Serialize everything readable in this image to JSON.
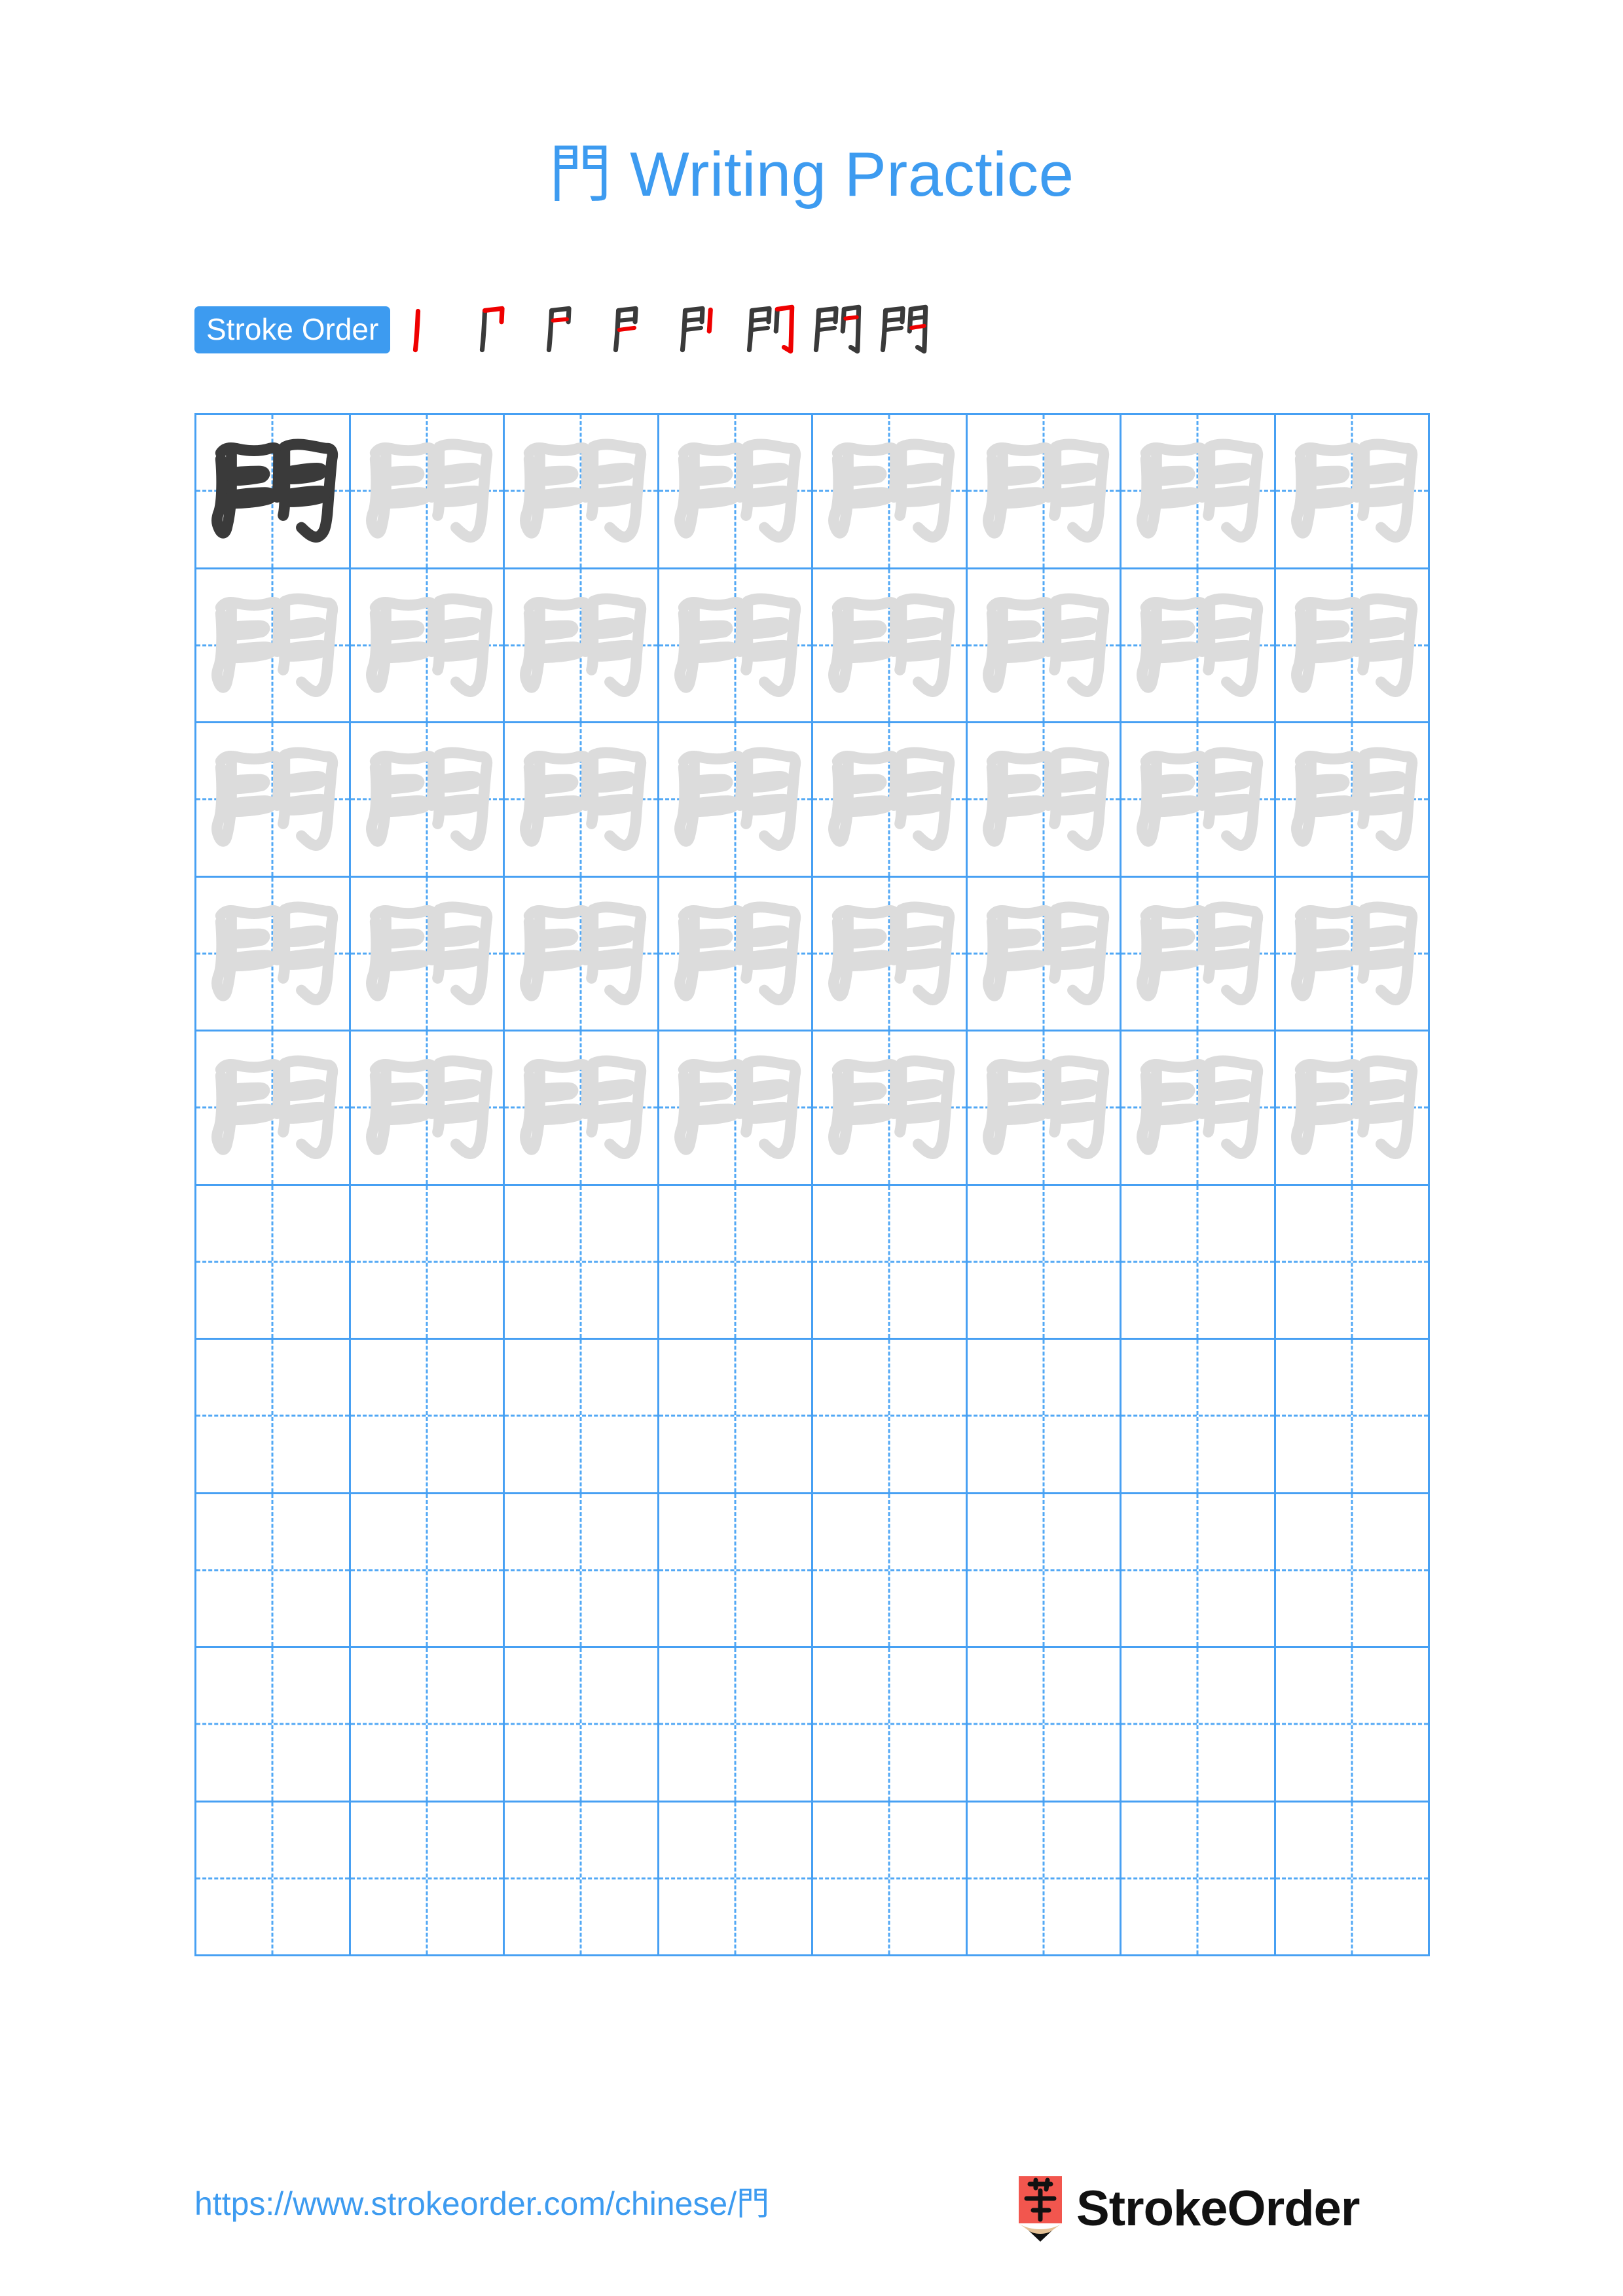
{
  "page": {
    "character": "門",
    "title": "門 Writing Practice",
    "title_prefix_char": "門",
    "title_text": " Writing Practice",
    "background_color": "#ffffff",
    "accent_color": "#3d9bf0",
    "grid_line_color": "#47a0f3",
    "guide_line_color": "#52a8f5",
    "trace_gray": "#dcdcdc",
    "solid_black": "#3a3a3a",
    "highlight_red": "#ef0000"
  },
  "stroke_order": {
    "badge_label": "Stroke Order",
    "total_strokes": 8,
    "steps": [
      {
        "index": 1,
        "strokes_shown": 1,
        "new_stroke": 1,
        "name": "shu"
      },
      {
        "index": 2,
        "strokes_shown": 2,
        "new_stroke": 2,
        "name": "heng-zhe-gou"
      },
      {
        "index": 3,
        "strokes_shown": 3,
        "new_stroke": 3,
        "name": "heng"
      },
      {
        "index": 4,
        "strokes_shown": 4,
        "new_stroke": 4,
        "name": "heng"
      },
      {
        "index": 5,
        "strokes_shown": 5,
        "new_stroke": 5,
        "name": "shu"
      },
      {
        "index": 6,
        "strokes_shown": 6,
        "new_stroke": 6,
        "name": "heng-zhe-gou"
      },
      {
        "index": 7,
        "strokes_shown": 7,
        "new_stroke": 7,
        "name": "heng"
      },
      {
        "index": 8,
        "strokes_shown": 8,
        "new_stroke": 8,
        "name": "heng"
      }
    ]
  },
  "practice_grid": {
    "columns": 8,
    "rows": 10,
    "cells": [
      [
        "solid",
        "trace",
        "trace",
        "trace",
        "trace",
        "trace",
        "trace",
        "trace"
      ],
      [
        "trace",
        "trace",
        "trace",
        "trace",
        "trace",
        "trace",
        "trace",
        "trace"
      ],
      [
        "trace",
        "trace",
        "trace",
        "trace",
        "trace",
        "trace",
        "trace",
        "trace"
      ],
      [
        "trace",
        "trace",
        "trace",
        "trace",
        "trace",
        "trace",
        "trace",
        "trace"
      ],
      [
        "trace",
        "trace",
        "trace",
        "trace",
        "trace",
        "trace",
        "trace",
        "trace"
      ],
      [
        "empty",
        "empty",
        "empty",
        "empty",
        "empty",
        "empty",
        "empty",
        "empty"
      ],
      [
        "empty",
        "empty",
        "empty",
        "empty",
        "empty",
        "empty",
        "empty",
        "empty"
      ],
      [
        "empty",
        "empty",
        "empty",
        "empty",
        "empty",
        "empty",
        "empty",
        "empty"
      ],
      [
        "empty",
        "empty",
        "empty",
        "empty",
        "empty",
        "empty",
        "empty",
        "empty"
      ],
      [
        "empty",
        "empty",
        "empty",
        "empty",
        "empty",
        "empty",
        "empty",
        "empty"
      ]
    ]
  },
  "footer": {
    "url": "https://www.strokeorder.com/chinese/門",
    "brand_name": "StrokeOrder",
    "logo_char": "字",
    "logo_body_color": "#f2564e",
    "logo_wood_color": "#e5c195",
    "logo_tip_color": "#111111"
  }
}
